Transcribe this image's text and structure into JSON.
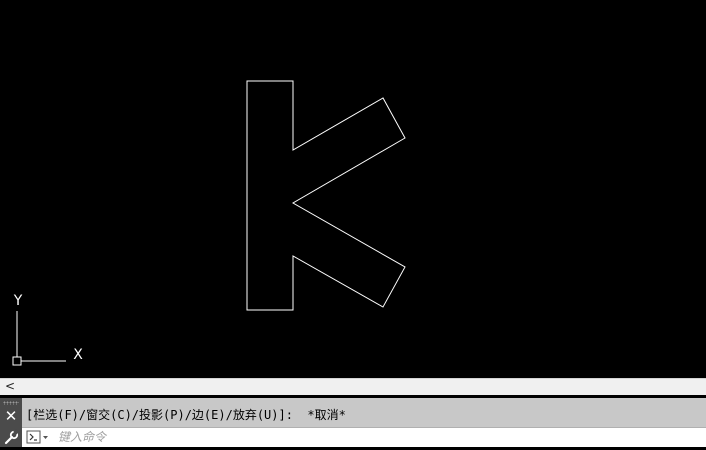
{
  "canvas": {
    "background": "#000000",
    "stroke_color": "#ffffff",
    "ucs": {
      "x_label": "X",
      "y_label": "Y"
    }
  },
  "scrollbar": {
    "left_arrow": "<"
  },
  "command_line": {
    "history": "[栏选(F)/窗交(C)/投影(P)/边(E)/放弃(U)]:  *取消*",
    "input_placeholder": "键入命令",
    "close_glyph": "✕"
  }
}
